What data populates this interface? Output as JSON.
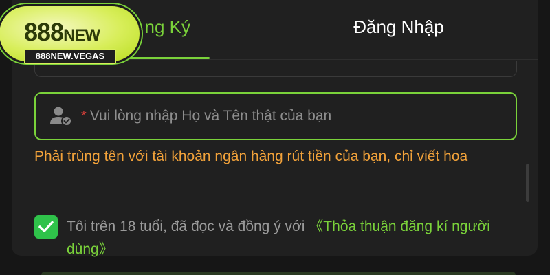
{
  "logo": {
    "main": "888",
    "main_suffix": "NEW",
    "sub": "888NEW.VEGAS"
  },
  "tabs": {
    "register": "Đăng Ký",
    "register_visible": "ng Ký",
    "login": "Đăng Nhập"
  },
  "name_field": {
    "required_mark": "*",
    "placeholder": "Vui lòng nhập Họ và Tên thật của bạn",
    "value": "",
    "icon": "user-verified-icon"
  },
  "hint": "Phải trùng tên với tài khoản ngân hàng rút tiền của bạn, chỉ viết hoa",
  "terms": {
    "checked": true,
    "text": "Tôi trên 18 tuổi, đã đọc và đồng ý với ",
    "link": "《Thỏa thuận đăng kí người dùng》"
  },
  "colors": {
    "accent": "#7ad23a",
    "hint": "#f2a23a",
    "checkbox": "#2fc24a",
    "required": "#e0403a"
  }
}
